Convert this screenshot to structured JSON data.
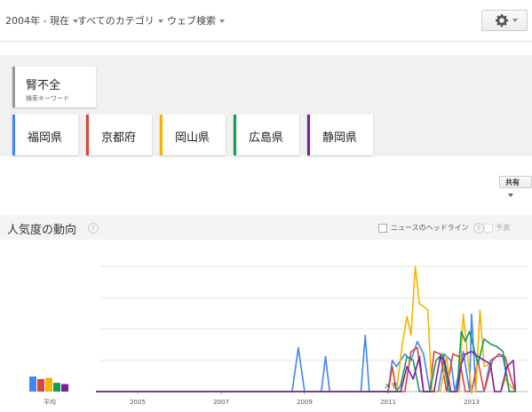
{
  "toolbar": {
    "period": "2004年 - 現在",
    "category": "すべてのカテゴリ",
    "search_type": "ウェブ検索",
    "settings_icon": "gear-icon"
  },
  "keyword": {
    "term": "腎不全",
    "label": "検索キーワード"
  },
  "compare_terms": [
    {
      "label": "福岡県",
      "color": "#4285f4"
    },
    {
      "label": "京都府",
      "color": "#db4437"
    },
    {
      "label": "岡山県",
      "color": "#f4b400"
    },
    {
      "label": "広島県",
      "color": "#0f9d58"
    },
    {
      "label": "静岡県",
      "color": "#7b1fa2"
    }
  ],
  "share_label": "共有",
  "section": {
    "title": "人気度の動向",
    "help": "?",
    "news_headlines": "ニュースのヘッドライン",
    "forecast": "予測"
  },
  "chart_data": {
    "type": "line",
    "x_ticks": [
      "2005",
      "2007",
      "2009",
      "2011",
      "2013"
    ],
    "average_label": "平均",
    "annotation": "メモ",
    "average_bars": [
      {
        "name": "福岡県",
        "value": 12
      },
      {
        "name": "京都府",
        "value": 10
      },
      {
        "name": "岡山県",
        "value": 11
      },
      {
        "name": "広島県",
        "value": 7
      },
      {
        "name": "静岡県",
        "value": 6
      }
    ],
    "ylim": [
      0,
      100
    ],
    "grid": true,
    "series": [
      {
        "name": "福岡県",
        "color": "#4285f4",
        "points": [
          [
            2004,
            0
          ],
          [
            2008.7,
            0
          ],
          [
            2008.85,
            35
          ],
          [
            2009.0,
            0
          ],
          [
            2009.4,
            0
          ],
          [
            2009.5,
            28
          ],
          [
            2009.6,
            0
          ],
          [
            2010.35,
            0
          ],
          [
            2010.45,
            45
          ],
          [
            2010.55,
            0
          ],
          [
            2011,
            0
          ],
          [
            2011.1,
            25
          ],
          [
            2011.2,
            20
          ],
          [
            2011.4,
            30
          ],
          [
            2011.55,
            25
          ],
          [
            2011.7,
            40
          ],
          [
            2011.85,
            30
          ],
          [
            2012.0,
            0
          ],
          [
            2012.2,
            0
          ],
          [
            2012.35,
            30
          ],
          [
            2012.5,
            25
          ],
          [
            2012.6,
            0
          ],
          [
            2012.8,
            32
          ],
          [
            2012.95,
            0
          ],
          [
            2013.0,
            62
          ],
          [
            2013.1,
            0
          ],
          [
            2013.3,
            0
          ],
          [
            2013.45,
            25
          ],
          [
            2013.6,
            28
          ],
          [
            2013.75,
            28
          ],
          [
            2013.9,
            0
          ],
          [
            2014.05,
            0
          ]
        ]
      },
      {
        "name": "京都府",
        "color": "#db4437",
        "points": [
          [
            2004,
            0
          ],
          [
            2011.0,
            0
          ],
          [
            2011.1,
            20
          ],
          [
            2011.2,
            0
          ],
          [
            2011.4,
            0
          ],
          [
            2011.55,
            32
          ],
          [
            2011.7,
            35
          ],
          [
            2011.85,
            0
          ],
          [
            2012.0,
            0
          ],
          [
            2012.1,
            32
          ],
          [
            2012.25,
            30
          ],
          [
            2012.4,
            0
          ],
          [
            2012.55,
            30
          ],
          [
            2012.7,
            28
          ],
          [
            2012.85,
            0
          ],
          [
            2013.0,
            0
          ],
          [
            2013.15,
            25
          ],
          [
            2013.3,
            0
          ],
          [
            2013.5,
            25
          ],
          [
            2013.65,
            30
          ],
          [
            2013.8,
            28
          ],
          [
            2013.95,
            10
          ],
          [
            2014.05,
            0
          ]
        ]
      },
      {
        "name": "岡山県",
        "color": "#f4b400",
        "points": [
          [
            2004,
            0
          ],
          [
            2011.0,
            0
          ],
          [
            2011.2,
            0
          ],
          [
            2011.35,
            40
          ],
          [
            2011.45,
            60
          ],
          [
            2011.55,
            45
          ],
          [
            2011.65,
            100
          ],
          [
            2011.75,
            70
          ],
          [
            2011.85,
            68
          ],
          [
            2011.95,
            65
          ],
          [
            2012.05,
            0
          ],
          [
            2012.25,
            0
          ],
          [
            2012.4,
            28
          ],
          [
            2012.5,
            0
          ],
          [
            2012.7,
            0
          ],
          [
            2012.8,
            62
          ],
          [
            2012.9,
            30
          ],
          [
            2013.0,
            0
          ],
          [
            2013.1,
            0
          ],
          [
            2013.2,
            65
          ],
          [
            2013.3,
            20
          ],
          [
            2013.45,
            22
          ],
          [
            2013.55,
            0
          ],
          [
            2013.7,
            0
          ],
          [
            2013.8,
            10
          ],
          [
            2014.05,
            0
          ]
        ]
      },
      {
        "name": "広島県",
        "color": "#0f9d58",
        "points": [
          [
            2004,
            0
          ],
          [
            2011.2,
            0
          ],
          [
            2011.3,
            5
          ],
          [
            2011.45,
            28
          ],
          [
            2011.6,
            25
          ],
          [
            2011.75,
            0
          ],
          [
            2012.0,
            0
          ],
          [
            2012.15,
            25
          ],
          [
            2012.3,
            30
          ],
          [
            2012.45,
            0
          ],
          [
            2012.65,
            0
          ],
          [
            2012.75,
            48
          ],
          [
            2012.85,
            40
          ],
          [
            2012.95,
            48
          ],
          [
            2013.05,
            35
          ],
          [
            2013.15,
            22
          ],
          [
            2013.3,
            42
          ],
          [
            2013.45,
            38
          ],
          [
            2013.6,
            36
          ],
          [
            2013.75,
            32
          ],
          [
            2013.9,
            0
          ],
          [
            2014.05,
            0
          ]
        ]
      },
      {
        "name": "静岡県",
        "color": "#7b1fa2",
        "points": [
          [
            2004,
            0
          ],
          [
            2011.3,
            0
          ],
          [
            2011.45,
            20
          ],
          [
            2011.6,
            10
          ],
          [
            2011.75,
            28
          ],
          [
            2011.85,
            0
          ],
          [
            2012.1,
            0
          ],
          [
            2012.25,
            28
          ],
          [
            2012.35,
            25
          ],
          [
            2012.5,
            0
          ],
          [
            2012.65,
            0
          ],
          [
            2012.75,
            22
          ],
          [
            2012.85,
            30
          ],
          [
            2013.0,
            32
          ],
          [
            2013.15,
            28
          ],
          [
            2013.3,
            25
          ],
          [
            2013.45,
            22
          ],
          [
            2013.55,
            0
          ],
          [
            2013.7,
            0
          ],
          [
            2013.85,
            20
          ],
          [
            2014.0,
            25
          ],
          [
            2014.05,
            0
          ]
        ]
      }
    ]
  }
}
